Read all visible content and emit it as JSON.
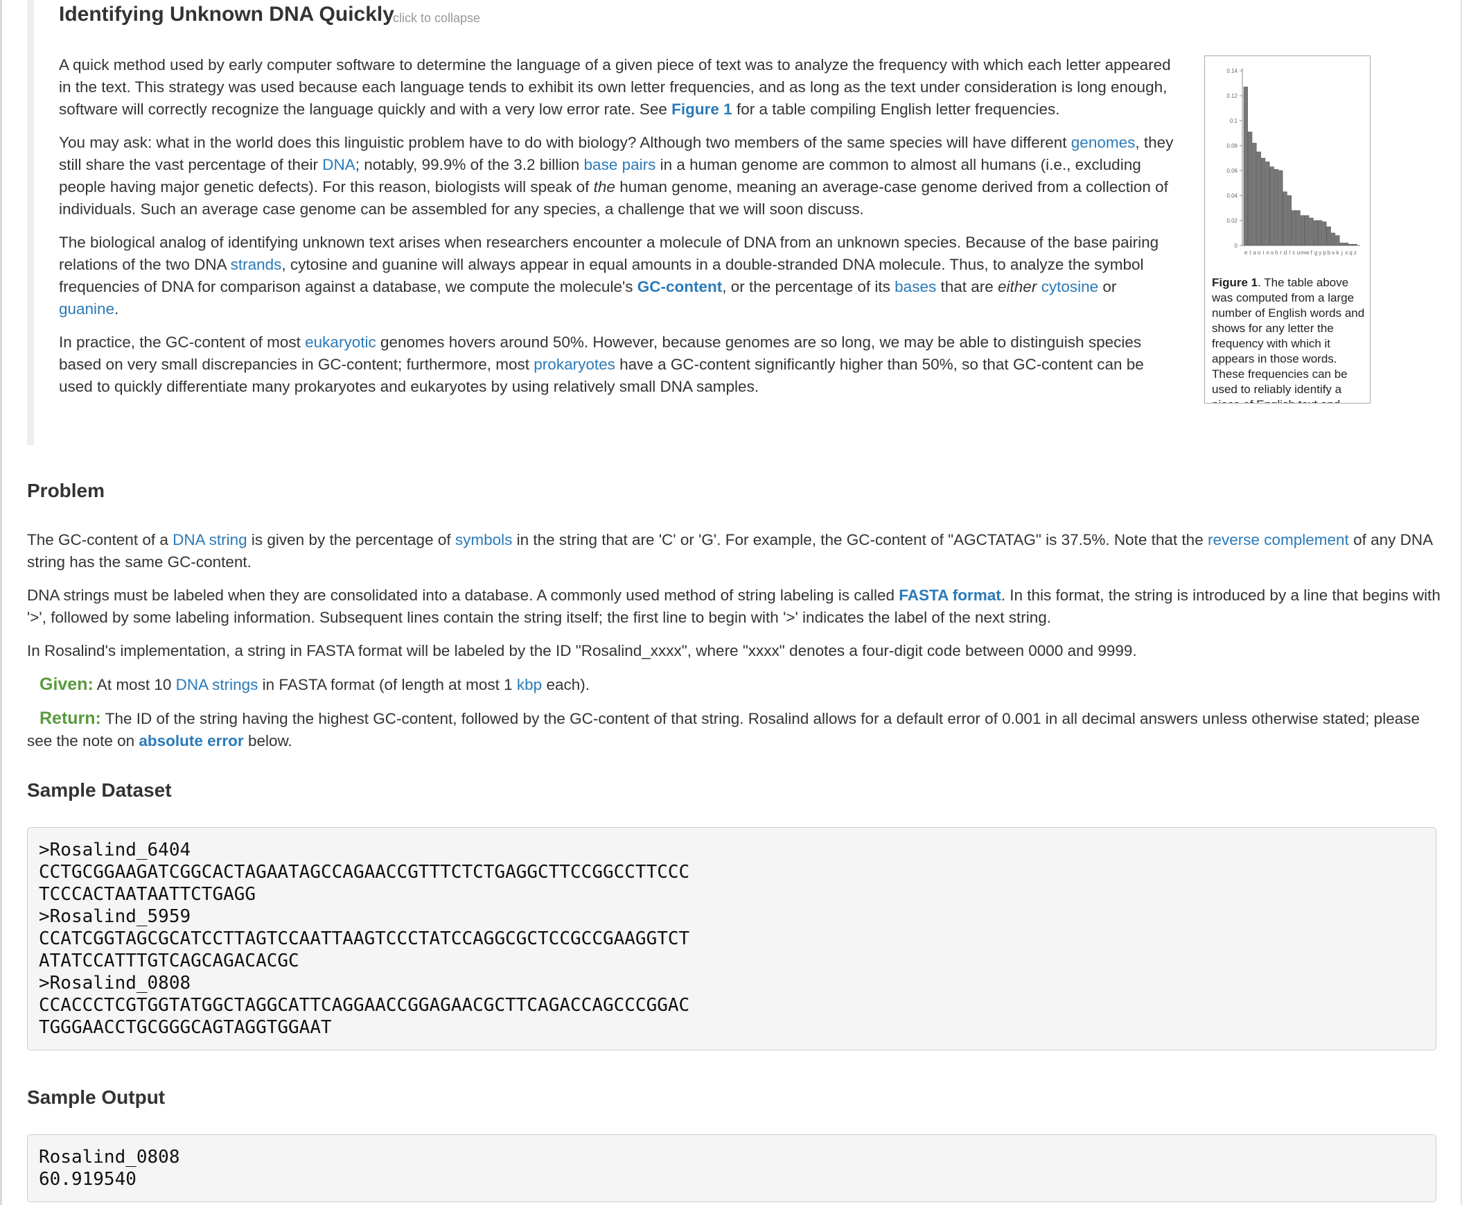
{
  "intro": {
    "title": "Identifying Unknown DNA Quickly",
    "collapse_hint": "click to collapse",
    "p1": {
      "a": "A quick method used by early computer software to determine the language of a given piece of text was to analyze the frequency with which each letter appeared in the text. This strategy was used because each language tends to exhibit its own letter frequencies, and as long as the text under consideration is long enough, software will correctly recognize the language quickly and with a very low error rate. See ",
      "link": "Figure 1",
      "b": " for a table compiling English letter frequencies."
    },
    "p2": {
      "a": "You may ask: what in the world does this linguistic problem have to do with biology? Although two members of the same species will have different ",
      "l1": "genomes",
      "b": ", they still share the vast percentage of their ",
      "l2": "DNA",
      "c": "; notably, 99.9% of the 3.2 billion ",
      "l3": "base pairs",
      "d": " in a human genome are common to almost all humans (i.e., excluding people having major genetic defects). For this reason, biologists will speak of ",
      "em": "the",
      "e": " human genome, meaning an average-case genome derived from a collection of individuals. Such an average case genome can be assembled for any species, a challenge that we will soon discuss."
    },
    "p3": {
      "a": "The biological analog of identifying unknown text arises when researchers encounter a molecule of DNA from an unknown species. Because of the base pairing relations of the two DNA ",
      "l1": "strands",
      "b": ", cytosine and guanine will always appear in equal amounts in a double-stranded DNA molecule. Thus, to analyze the symbol frequencies of DNA for comparison against a database, we compute the molecule's ",
      "l2": "GC-content",
      "c": ", or the percentage of its ",
      "l3": "bases",
      "d": " that are ",
      "em": "either",
      "e": " ",
      "l4": "cytosine",
      "f": " or ",
      "l5": "guanine",
      "g": "."
    },
    "p4": {
      "a": "In practice, the GC-content of most ",
      "l1": "eukaryotic",
      "b": " genomes hovers around 50%. However, because genomes are so long, we may be able to distinguish species based on very small discrepancies in GC-content; furthermore, most ",
      "l2": "prokaryotes",
      "c": " have a GC-content significantly higher than 50%, so that GC-content can be used to quickly differentiate many prokaryotes and eukaryotes by using relatively small DNA samples."
    }
  },
  "figure": {
    "caption_label": "Figure 1",
    "caption_text": ". The table above was computed from a large number of English words and shows for any letter the frequency with which it appears in those words. These frequencies can be used to reliably identify a piece of English text and differentiate it from that of another language. Taken from http://en.wikipedia.org/wiki/File:English_letter_frequency"
  },
  "chart_data": {
    "type": "bar",
    "categories": [
      "e",
      "t",
      "a",
      "o",
      "i",
      "n",
      "s",
      "h",
      "r",
      "d",
      "l",
      "c",
      "u",
      "m",
      "w",
      "f",
      "g",
      "y",
      "p",
      "b",
      "v",
      "k",
      "j",
      "x",
      "q",
      "z"
    ],
    "values": [
      0.127,
      0.091,
      0.082,
      0.075,
      0.07,
      0.067,
      0.063,
      0.061,
      0.06,
      0.043,
      0.04,
      0.028,
      0.028,
      0.024,
      0.024,
      0.022,
      0.02,
      0.02,
      0.019,
      0.015,
      0.01,
      0.008,
      0.002,
      0.002,
      0.001,
      0.001
    ],
    "yticks": [
      "0.14",
      "0.12",
      "0.1",
      "0.08",
      "0.06",
      "0.04",
      "0.02",
      "0"
    ],
    "ylim": [
      0,
      0.14
    ],
    "bar_color": "#777777"
  },
  "problem": {
    "heading": "Problem",
    "p1": {
      "a": "The GC-content of a ",
      "l1": "DNA string",
      "b": " is given by the percentage of ",
      "l2": "symbols",
      "c": " in the string that are 'C' or 'G'. For example, the GC-content of \"AGCTATAG\" is 37.5%. Note that the ",
      "l3": "reverse complement",
      "d": " of any DNA string has the same GC-content."
    },
    "p2": {
      "a": "DNA strings must be labeled when they are consolidated into a database. A commonly used method of string labeling is called ",
      "l1": "FASTA format",
      "b": ". In this format, the string is introduced by a line that begins with '>', followed by some labeling information. Subsequent lines contain the string itself; the first line to begin with '>' indicates the label of the next string."
    },
    "p3": "In Rosalind's implementation, a string in FASTA format will be labeled by the ID \"Rosalind_xxxx\", where \"xxxx\" denotes a four-digit code between 0000 and 9999.",
    "given": {
      "label": "Given:",
      "a": " At most 10 ",
      "l1": "DNA strings",
      "b": " in FASTA format (of length at most 1 ",
      "l2": "kbp",
      "c": " each)."
    },
    "return": {
      "label": "Return:",
      "a": " The ID of the string having the highest GC-content, followed by the GC-content of that string. Rosalind allows for a default error of 0.001 in all decimal answers unless otherwise stated; please see the note on ",
      "l1": "absolute error",
      "b": " below."
    }
  },
  "sample_dataset": {
    "heading": "Sample Dataset",
    "lines": [
      ">Rosalind_6404",
      "CCTGCGGAAGATCGGCACTAGAATAGCCAGAACCGTTTCTCTGAGGCTTCCGGCCTTCCC",
      "TCCCACTAATAATTCTGAGG",
      ">Rosalind_5959",
      "CCATCGGTAGCGCATCCTTAGTCCAATTAAGTCCCTATCCAGGCGCTCCGCCGAAGGTCT",
      "ATATCCATTTGTCAGCAGACACGC",
      ">Rosalind_0808",
      "CCACCCTCGTGGTATGGCTAGGCATTCAGGAACCGGAGAACGCTTCAGACCAGCCCGGAC",
      "TGGGAACCTGCGGGCAGTAGGTGGAAT"
    ]
  },
  "sample_output": {
    "heading": "Sample Output",
    "lines": [
      "Rosalind_0808",
      "60.919540"
    ]
  }
}
